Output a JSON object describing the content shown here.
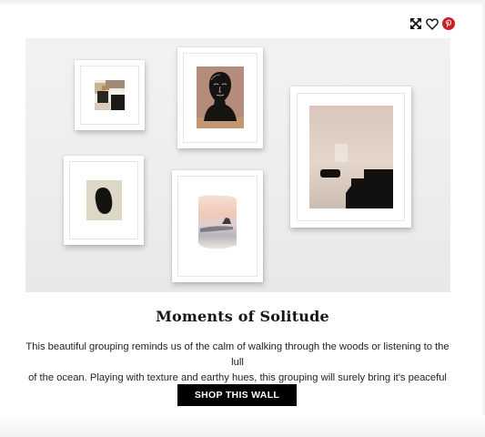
{
  "actions": {
    "expand_icon": "expand-icon",
    "favorite_icon": "heart-icon",
    "pinterest_icon": "pinterest-icon",
    "pinterest_color": "#cb2027"
  },
  "wall": {
    "artworks": [
      {
        "name": "abstract-collage-print"
      },
      {
        "name": "black-figure-bust-print"
      },
      {
        "name": "neutral-abstract-landscape-print"
      },
      {
        "name": "black-stone-print"
      },
      {
        "name": "sunset-watercolor-print"
      }
    ]
  },
  "product": {
    "title": "Moments of Solitude",
    "description_line1": "This beautiful grouping reminds us of the calm of walking through the woods or listening to the lull",
    "description_line2": "of the ocean. Playing with texture and earthy hues, this grouping will surely bring it's peaceful spi...",
    "cta_label": "SHOP THIS WALL"
  },
  "colors": {
    "cta_background": "#000000",
    "cta_text": "#ffffff",
    "title_text": "#151515"
  }
}
